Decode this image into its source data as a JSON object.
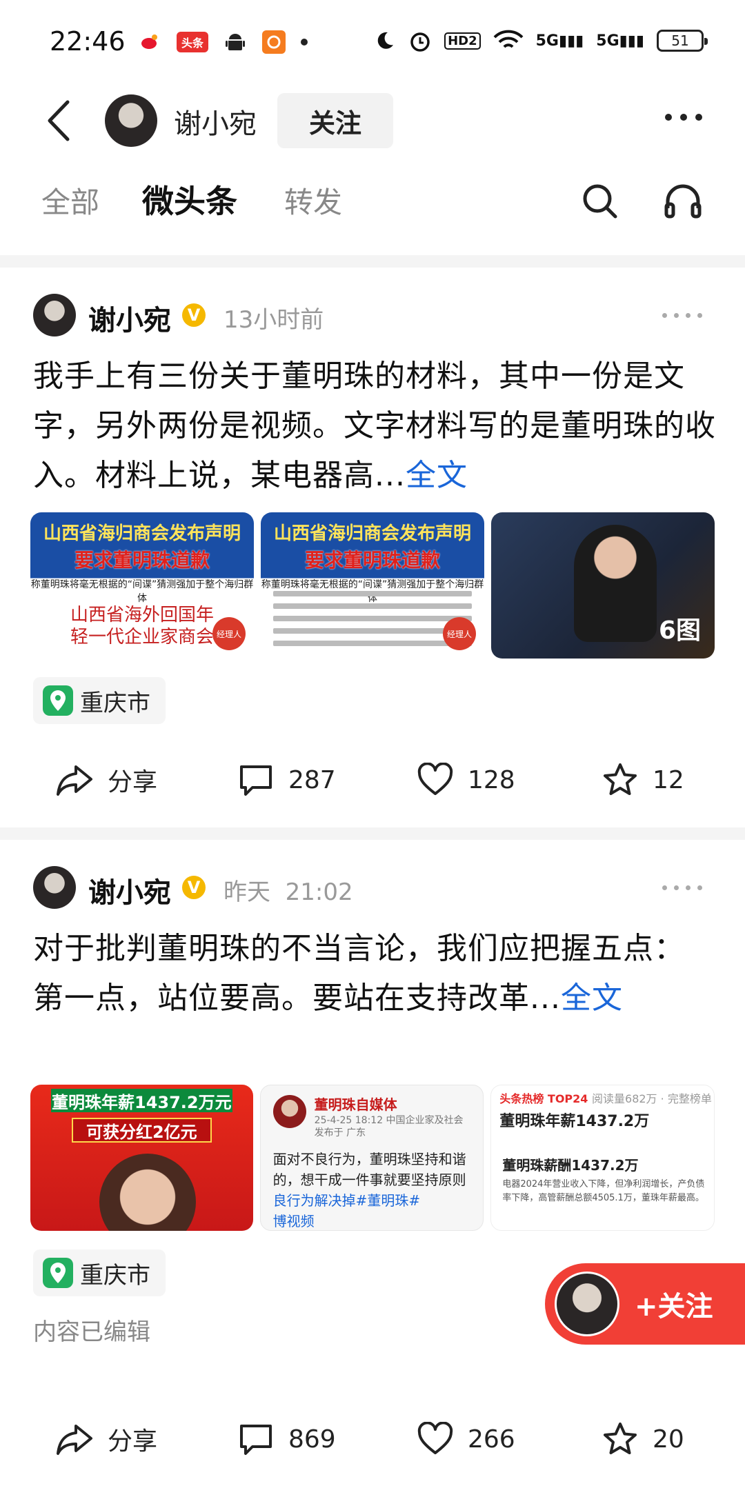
{
  "status": {
    "time": "22:46",
    "icons": [
      "weibo-icon",
      "toutiao-icon",
      "android-icon",
      "app-icon"
    ],
    "battery": "51",
    "network": [
      "HD2",
      "5G",
      "5G"
    ]
  },
  "header": {
    "username": "谢小宛",
    "follow_label": "关注"
  },
  "tabs": [
    {
      "label": "全部"
    },
    {
      "label": "微头条"
    },
    {
      "label": "转发"
    }
  ],
  "posts": [
    {
      "author": "谢小宛",
      "time": "13小时前",
      "text": "我手上有三份关于董明珠的材料，其中一份是文字，另外两份是视频。文字材料写的是董明珠的收入。材料上说，某电器高...",
      "more_link": "全文",
      "images": {
        "img1": {
          "title": "山西省海归商会发布声明",
          "subtitle": "要求董明珠道歉",
          "line": "称董明珠将毫无根据的“间谍”猜测强加于整个海归群体",
          "org1": "山西省海外回国年",
          "org2": "轻一代企业家商会",
          "badge": "经理人"
        },
        "img2": {
          "title": "山西省海归商会发布声明",
          "subtitle": "要求董明珠道歉",
          "line": "称董明珠将毫无根据的“间谍”猜测强加于整个海归群体",
          "badge": "经理人"
        },
        "img3": {
          "count": "6图"
        }
      },
      "location": "重庆市",
      "share_label": "分享",
      "comments": "287",
      "likes": "128",
      "favorites": "12"
    },
    {
      "author": "谢小宛",
      "time": "昨天  21:02",
      "text_line1": "对于批判董明珠的不当言论，我们应把握五点：",
      "text_line2": "第一点，站位要高。要站在支持改革...",
      "more_link": "全文",
      "images": {
        "img1": {
          "banner1": "董明珠年薪1437.2万元",
          "banner2": "可获分红2亿元"
        },
        "img2": {
          "name": "董明珠自媒体",
          "meta1": "25-4-25 18:12  中国企业家及社会",
          "meta2": "发布于 广东",
          "body1": "面对不良行为，董明珠坚持和谐",
          "body2": "的，想干成一件事就要坚持原则",
          "body3": "良行为解决掉#董明珠#",
          "body4": "博视频"
        },
        "img3": {
          "hot_label": "头条热榜 TOP24",
          "hot_meta": "阅读量682万 · 完整榜单",
          "headline": "董明珠年薪1437.2万",
          "sub": "董明珠薪酬1437.2万",
          "desc": "电器2024年营业收入下降，但净利润增长，产负债率下降，高管薪酬总额4505.1万，董珠年薪最高。"
        }
      },
      "location": "重庆市",
      "edited": "内容已编辑",
      "share_label": "分享",
      "comments": "869",
      "likes": "266",
      "favorites": "20"
    }
  ],
  "float_follow": {
    "label": "+关注"
  },
  "colors": {
    "link": "#1a66d9",
    "follow_red": "#f13f36",
    "verified": "#f5b800",
    "location": "#23b060"
  }
}
